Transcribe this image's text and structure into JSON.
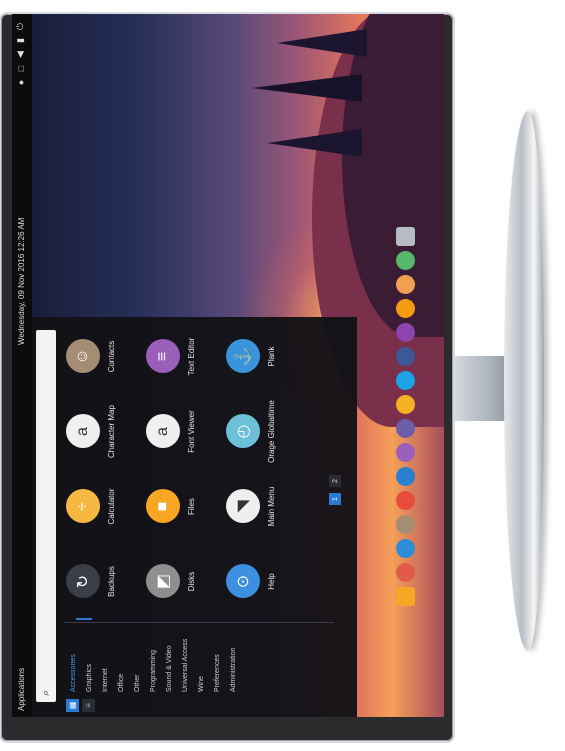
{
  "top_panel": {
    "apps_label": "Applications",
    "clock": "Wednesday, 09 Nov 2016 12:26 AM",
    "tray": [
      {
        "icon": "user-icon",
        "glyph": "●"
      },
      {
        "icon": "network-icon",
        "glyph": "□"
      },
      {
        "icon": "volume-icon",
        "glyph": "◀"
      },
      {
        "icon": "battery-icon",
        "glyph": "▮"
      },
      {
        "icon": "power-icon",
        "glyph": "⏻"
      }
    ]
  },
  "launcher": {
    "search_placeholder": "",
    "categories": [
      "Accessories",
      "Graphics",
      "Internet",
      "Office",
      "Other",
      "Programming",
      "Sound & Video",
      "Universal Access",
      "Wine",
      "Preferences",
      "Administration"
    ],
    "apps": [
      {
        "label": "Backups",
        "icon": "backups-icon",
        "color": "#3a3f47",
        "glyph": "↻"
      },
      {
        "label": "Calculator",
        "icon": "calculator-icon",
        "color": "#f6b841",
        "glyph": "÷"
      },
      {
        "label": "Character Map",
        "icon": "character-map-icon",
        "color": "#efefef",
        "glyph": "a"
      },
      {
        "label": "Contacts",
        "icon": "contacts-icon",
        "color": "#a58d73",
        "glyph": "☺"
      },
      {
        "label": "Disks",
        "icon": "disks-icon",
        "color": "#8f8f8f",
        "glyph": "◩"
      },
      {
        "label": "Files",
        "icon": "files-icon",
        "color": "#f7a623",
        "glyph": "■"
      },
      {
        "label": "Font Viewer",
        "icon": "font-viewer-icon",
        "color": "#efefef",
        "glyph": "a"
      },
      {
        "label": "Text Editor",
        "icon": "text-editor-icon",
        "color": "#9a5fb8",
        "glyph": "≡"
      },
      {
        "label": "Help",
        "icon": "help-icon",
        "color": "#3d8fe0",
        "glyph": "⊙"
      },
      {
        "label": "Main Menu",
        "icon": "main-menu-icon",
        "color": "#efefef",
        "glyph": "◥"
      },
      {
        "label": "Orage Globaltime",
        "icon": "orage-globaltime-icon",
        "color": "#6cc0d8",
        "glyph": "◴"
      },
      {
        "label": "Plank",
        "icon": "plank-icon",
        "color": "#3a94d9",
        "glyph": "⚓"
      }
    ],
    "pages": [
      "1",
      "2"
    ]
  },
  "dock": [
    {
      "icon": "files-dock-icon",
      "color": "#f7a623"
    },
    {
      "icon": "mail-icon",
      "color": "#e25b4a"
    },
    {
      "icon": "browser-icon",
      "color": "#2e8bd6"
    },
    {
      "icon": "contacts-dock-icon",
      "color": "#a58d73"
    },
    {
      "icon": "calendar-icon",
      "color": "#e74c3c"
    },
    {
      "icon": "web-icon",
      "color": "#2b7fd1"
    },
    {
      "icon": "notes-icon",
      "color": "#9a5fb8"
    },
    {
      "icon": "social-icon",
      "color": "#6b5da8"
    },
    {
      "icon": "music-icon",
      "color": "#f5b024"
    },
    {
      "icon": "skype-icon",
      "color": "#1ea4e6"
    },
    {
      "icon": "photos-icon",
      "color": "#3b5998"
    },
    {
      "icon": "chat-icon",
      "color": "#8e44ad"
    },
    {
      "icon": "media-icon",
      "color": "#f39c12"
    },
    {
      "icon": "software-icon",
      "color": "#f0a050"
    },
    {
      "icon": "settings-icon",
      "color": "#55b86a"
    },
    {
      "icon": "trash-icon",
      "color": "#b7bcc2"
    }
  ]
}
